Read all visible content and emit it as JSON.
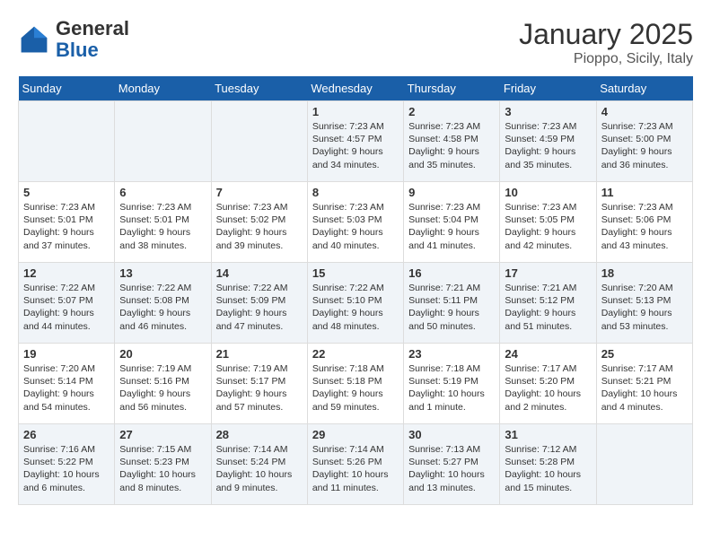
{
  "logo": {
    "general": "General",
    "blue": "Blue"
  },
  "header": {
    "title": "January 2025",
    "subtitle": "Pioppo, Sicily, Italy"
  },
  "days_of_week": [
    "Sunday",
    "Monday",
    "Tuesday",
    "Wednesday",
    "Thursday",
    "Friday",
    "Saturday"
  ],
  "weeks": [
    [
      {
        "day": "",
        "content": ""
      },
      {
        "day": "",
        "content": ""
      },
      {
        "day": "",
        "content": ""
      },
      {
        "day": "1",
        "content": "Sunrise: 7:23 AM\nSunset: 4:57 PM\nDaylight: 9 hours\nand 34 minutes."
      },
      {
        "day": "2",
        "content": "Sunrise: 7:23 AM\nSunset: 4:58 PM\nDaylight: 9 hours\nand 35 minutes."
      },
      {
        "day": "3",
        "content": "Sunrise: 7:23 AM\nSunset: 4:59 PM\nDaylight: 9 hours\nand 35 minutes."
      },
      {
        "day": "4",
        "content": "Sunrise: 7:23 AM\nSunset: 5:00 PM\nDaylight: 9 hours\nand 36 minutes."
      }
    ],
    [
      {
        "day": "5",
        "content": "Sunrise: 7:23 AM\nSunset: 5:01 PM\nDaylight: 9 hours\nand 37 minutes."
      },
      {
        "day": "6",
        "content": "Sunrise: 7:23 AM\nSunset: 5:01 PM\nDaylight: 9 hours\nand 38 minutes."
      },
      {
        "day": "7",
        "content": "Sunrise: 7:23 AM\nSunset: 5:02 PM\nDaylight: 9 hours\nand 39 minutes."
      },
      {
        "day": "8",
        "content": "Sunrise: 7:23 AM\nSunset: 5:03 PM\nDaylight: 9 hours\nand 40 minutes."
      },
      {
        "day": "9",
        "content": "Sunrise: 7:23 AM\nSunset: 5:04 PM\nDaylight: 9 hours\nand 41 minutes."
      },
      {
        "day": "10",
        "content": "Sunrise: 7:23 AM\nSunset: 5:05 PM\nDaylight: 9 hours\nand 42 minutes."
      },
      {
        "day": "11",
        "content": "Sunrise: 7:23 AM\nSunset: 5:06 PM\nDaylight: 9 hours\nand 43 minutes."
      }
    ],
    [
      {
        "day": "12",
        "content": "Sunrise: 7:22 AM\nSunset: 5:07 PM\nDaylight: 9 hours\nand 44 minutes."
      },
      {
        "day": "13",
        "content": "Sunrise: 7:22 AM\nSunset: 5:08 PM\nDaylight: 9 hours\nand 46 minutes."
      },
      {
        "day": "14",
        "content": "Sunrise: 7:22 AM\nSunset: 5:09 PM\nDaylight: 9 hours\nand 47 minutes."
      },
      {
        "day": "15",
        "content": "Sunrise: 7:22 AM\nSunset: 5:10 PM\nDaylight: 9 hours\nand 48 minutes."
      },
      {
        "day": "16",
        "content": "Sunrise: 7:21 AM\nSunset: 5:11 PM\nDaylight: 9 hours\nand 50 minutes."
      },
      {
        "day": "17",
        "content": "Sunrise: 7:21 AM\nSunset: 5:12 PM\nDaylight: 9 hours\nand 51 minutes."
      },
      {
        "day": "18",
        "content": "Sunrise: 7:20 AM\nSunset: 5:13 PM\nDaylight: 9 hours\nand 53 minutes."
      }
    ],
    [
      {
        "day": "19",
        "content": "Sunrise: 7:20 AM\nSunset: 5:14 PM\nDaylight: 9 hours\nand 54 minutes."
      },
      {
        "day": "20",
        "content": "Sunrise: 7:19 AM\nSunset: 5:16 PM\nDaylight: 9 hours\nand 56 minutes."
      },
      {
        "day": "21",
        "content": "Sunrise: 7:19 AM\nSunset: 5:17 PM\nDaylight: 9 hours\nand 57 minutes."
      },
      {
        "day": "22",
        "content": "Sunrise: 7:18 AM\nSunset: 5:18 PM\nDaylight: 9 hours\nand 59 minutes."
      },
      {
        "day": "23",
        "content": "Sunrise: 7:18 AM\nSunset: 5:19 PM\nDaylight: 10 hours\nand 1 minute."
      },
      {
        "day": "24",
        "content": "Sunrise: 7:17 AM\nSunset: 5:20 PM\nDaylight: 10 hours\nand 2 minutes."
      },
      {
        "day": "25",
        "content": "Sunrise: 7:17 AM\nSunset: 5:21 PM\nDaylight: 10 hours\nand 4 minutes."
      }
    ],
    [
      {
        "day": "26",
        "content": "Sunrise: 7:16 AM\nSunset: 5:22 PM\nDaylight: 10 hours\nand 6 minutes."
      },
      {
        "day": "27",
        "content": "Sunrise: 7:15 AM\nSunset: 5:23 PM\nDaylight: 10 hours\nand 8 minutes."
      },
      {
        "day": "28",
        "content": "Sunrise: 7:14 AM\nSunset: 5:24 PM\nDaylight: 10 hours\nand 9 minutes."
      },
      {
        "day": "29",
        "content": "Sunrise: 7:14 AM\nSunset: 5:26 PM\nDaylight: 10 hours\nand 11 minutes."
      },
      {
        "day": "30",
        "content": "Sunrise: 7:13 AM\nSunset: 5:27 PM\nDaylight: 10 hours\nand 13 minutes."
      },
      {
        "day": "31",
        "content": "Sunrise: 7:12 AM\nSunset: 5:28 PM\nDaylight: 10 hours\nand 15 minutes."
      },
      {
        "day": "",
        "content": ""
      }
    ]
  ]
}
